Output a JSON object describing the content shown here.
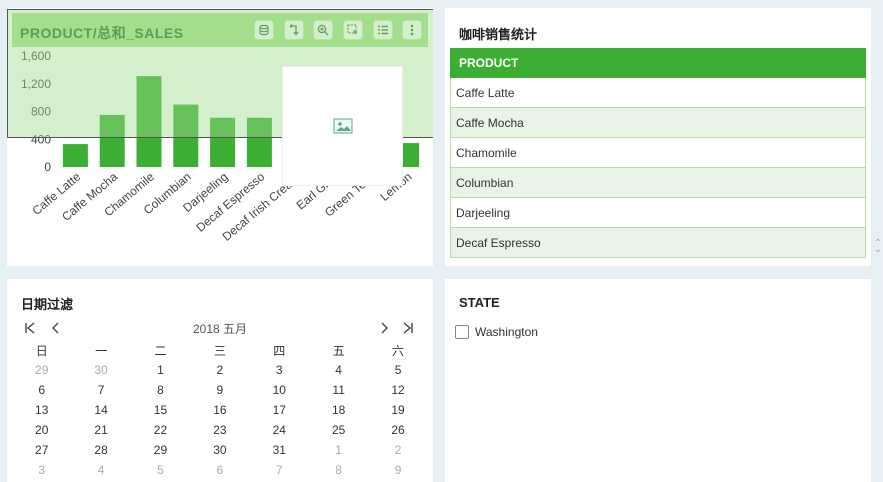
{
  "chart_panel": {
    "title": "PRODUCT/总和_SALES",
    "tools": [
      "database-icon",
      "swap-icon",
      "zoom-icon",
      "select-icon",
      "list-icon",
      "more-icon"
    ]
  },
  "chart_data": {
    "type": "bar",
    "categories": [
      "Caffe Latte",
      "Caffe Mocha",
      "Chamomile",
      "Columbian",
      "Darjeeling",
      "Decaf Espresso",
      "Decaf Irish Crea…",
      "Earl Gr…",
      "Green Te…",
      "Lemon"
    ],
    "values": [
      330,
      750,
      1310,
      900,
      710,
      710,
      null,
      null,
      null,
      345
    ],
    "ylim": [
      0,
      1600
    ],
    "yticks": [
      "0",
      "400",
      "800",
      "1,200",
      "1,600"
    ],
    "bar_color": "#3bae33",
    "grid": false
  },
  "table_panel": {
    "title": "咖啡销售统计",
    "header": "PRODUCT",
    "rows": [
      "Caffe Latte",
      "Caffe Mocha",
      "Chamomile",
      "Columbian",
      "Darjeeling",
      "Decaf Espresso"
    ]
  },
  "date_panel": {
    "title": "日期过滤",
    "month_label": "2018 五月",
    "weekdays": [
      "日",
      "一",
      "二",
      "三",
      "四",
      "五",
      "六"
    ],
    "weeks": [
      [
        "29",
        "30",
        "1",
        "2",
        "3",
        "4",
        "5"
      ],
      [
        "6",
        "7",
        "8",
        "9",
        "10",
        "11",
        "12"
      ],
      [
        "13",
        "14",
        "15",
        "16",
        "17",
        "18",
        "19"
      ],
      [
        "20",
        "21",
        "22",
        "23",
        "24",
        "25",
        "26"
      ],
      [
        "27",
        "28",
        "29",
        "30",
        "31",
        "1",
        "2"
      ],
      [
        "3",
        "4",
        "5",
        "6",
        "7",
        "8",
        "9"
      ]
    ],
    "muted": [
      [
        0,
        0
      ],
      [
        0,
        1
      ],
      [
        4,
        5
      ],
      [
        4,
        6
      ],
      [
        5,
        0
      ],
      [
        5,
        1
      ],
      [
        5,
        2
      ],
      [
        5,
        3
      ],
      [
        5,
        4
      ],
      [
        5,
        5
      ],
      [
        5,
        6
      ]
    ]
  },
  "state_panel": {
    "title": "STATE",
    "options": [
      {
        "label": "Washington",
        "checked": false
      }
    ]
  }
}
